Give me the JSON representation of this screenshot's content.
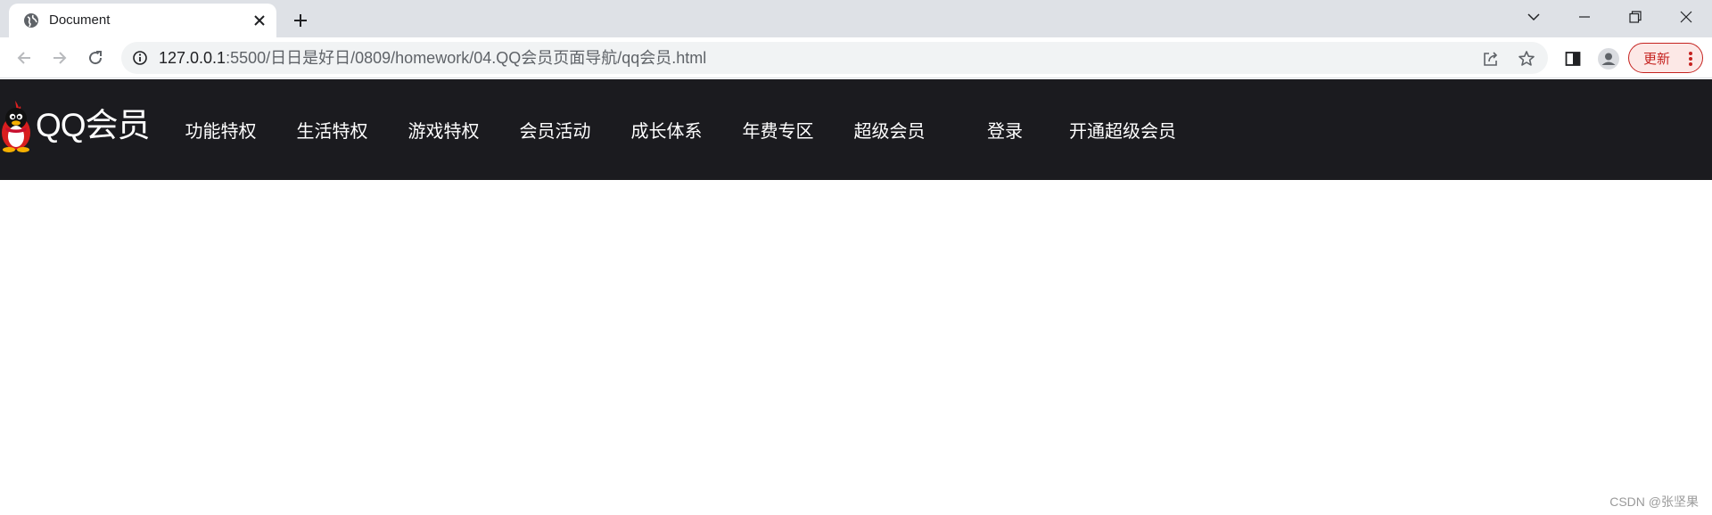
{
  "browser": {
    "tab": {
      "title": "Document"
    },
    "address_bar": {
      "url_host": "127.0.0.1",
      "url_rest": ":5500/日日是好日/0809/homework/04.QQ会员页面导航/qq会员.html"
    },
    "update_button": {
      "label": "更新"
    },
    "accent_color": "#c5221f"
  },
  "page": {
    "logo": {
      "text": "QQ会员"
    },
    "nav": {
      "items": [
        {
          "label": "功能特权"
        },
        {
          "label": "生活特权"
        },
        {
          "label": "游戏特权"
        },
        {
          "label": "会员活动"
        },
        {
          "label": "成长体系"
        },
        {
          "label": "年费专区"
        },
        {
          "label": "超级会员"
        }
      ],
      "login": {
        "label": "登录"
      },
      "open_super": {
        "label": "开通超级会员"
      }
    },
    "nav_bg_color": "#1b1b1f"
  },
  "watermark": "CSDN @张坚果"
}
